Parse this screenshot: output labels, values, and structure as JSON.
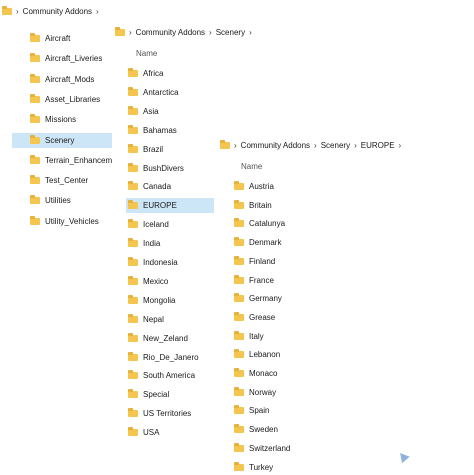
{
  "window1": {
    "breadcrumb": [
      "Community Addons"
    ],
    "items": [
      "Aircraft",
      "Aircraft_Liveries",
      "Aircraft_Mods",
      "Asset_Libraries",
      "Missions",
      "Scenery",
      "Terrain_Enhancements",
      "Test_Center",
      "Utilities",
      "Utility_Vehicles"
    ],
    "selected": "Scenery"
  },
  "window2": {
    "breadcrumb": [
      "Community Addons",
      "Scenery"
    ],
    "header": "Name",
    "items": [
      "Africa",
      "Antarctica",
      "Asia",
      "Bahamas",
      "Brazil",
      "BushDivers",
      "Canada",
      "EUROPE",
      "Iceland",
      "India",
      "Indonesia",
      "Mexico",
      "Mongolia",
      "Nepal",
      "New_Zeland",
      "Rio_De_Janero",
      "South America",
      "Special",
      "US Territories",
      "USA"
    ],
    "selected": "EUROPE"
  },
  "window3": {
    "breadcrumb": [
      "Community Addons",
      "Scenery",
      "EUROPE"
    ],
    "header": "Name",
    "items": [
      "Austria",
      "Britain",
      "Catalunya",
      "Denmark",
      "Finland",
      "France",
      "Germany",
      "Grease",
      "Italy",
      "Lebanon",
      "Monaco",
      "Norway",
      "Spain",
      "Sweden",
      "Switzerland",
      "Turkey"
    ]
  },
  "colors": {
    "folder": "#f5c64f",
    "selection": "#cde6f7"
  }
}
